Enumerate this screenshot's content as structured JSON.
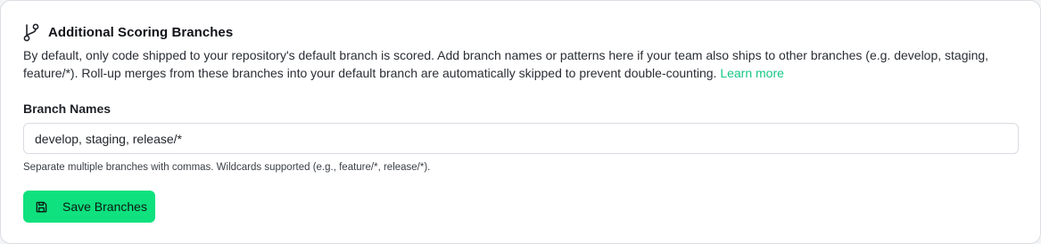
{
  "section": {
    "title": "Additional Scoring Branches",
    "icon": "git-branch-icon",
    "description_text": "By default, only code shipped to your repository's default branch is scored. Add branch names or patterns here if your team also ships to other branches (e.g. develop, staging, feature/*). Roll-up merges from these branches into your default branch are automatically skipped to prevent double-counting.",
    "learn_more_label": "Learn more"
  },
  "branch_field": {
    "label": "Branch Names",
    "value": "develop, staging, release/*",
    "help": "Separate multiple branches with commas. Wildcards supported (e.g., feature/*, release/*)."
  },
  "save_button": {
    "label": "Save Branches",
    "icon": "save-icon"
  },
  "colors": {
    "accent": "#0fe17e",
    "link": "#16c784"
  }
}
